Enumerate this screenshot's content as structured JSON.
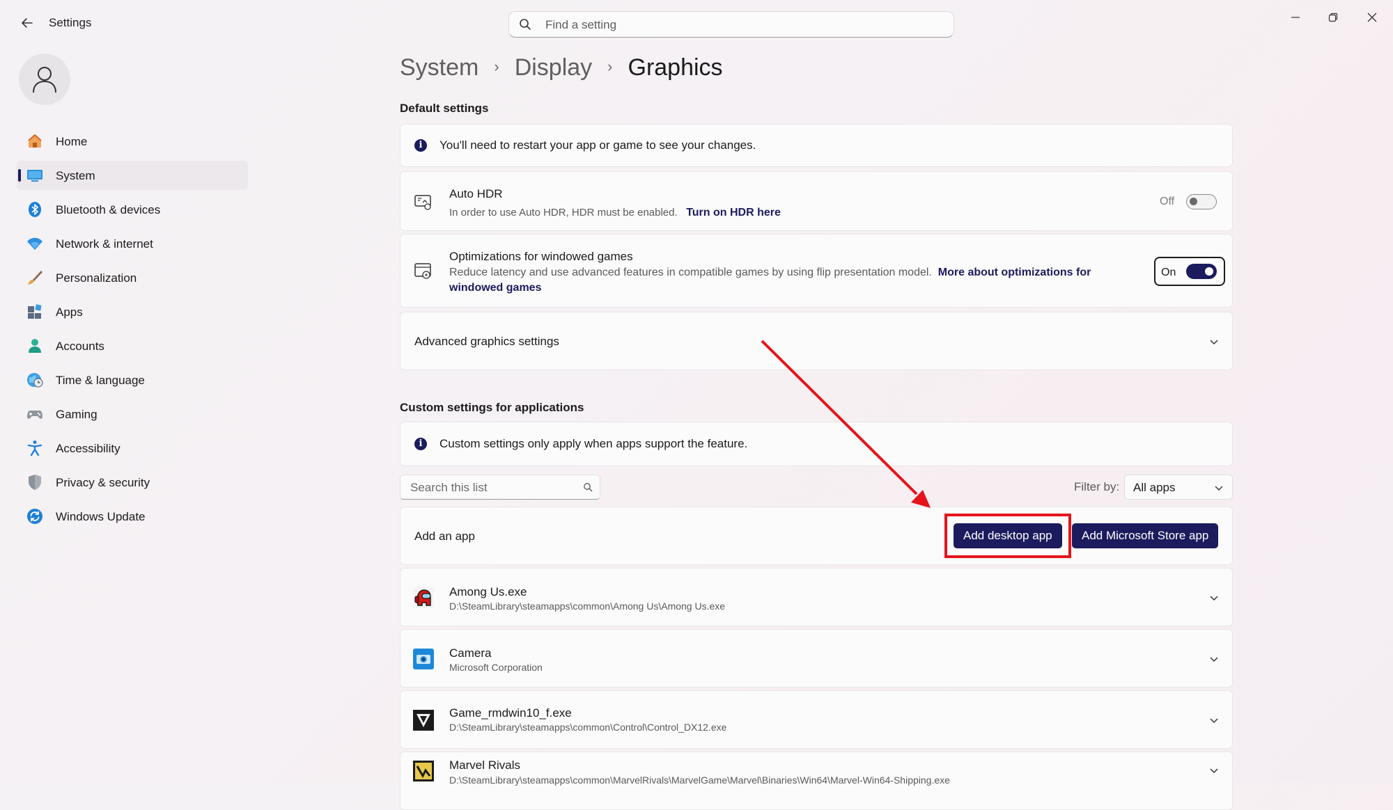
{
  "window": {
    "app_title": "Settings",
    "search_placeholder": "Find a setting"
  },
  "sidebar": {
    "items": [
      {
        "label": "Home",
        "icon": "home-icon"
      },
      {
        "label": "System",
        "icon": "system-icon",
        "active": true
      },
      {
        "label": "Bluetooth & devices",
        "icon": "bluetooth-icon"
      },
      {
        "label": "Network & internet",
        "icon": "network-icon"
      },
      {
        "label": "Personalization",
        "icon": "brush-icon"
      },
      {
        "label": "Apps",
        "icon": "apps-icon"
      },
      {
        "label": "Accounts",
        "icon": "accounts-icon"
      },
      {
        "label": "Time & language",
        "icon": "globe-clock-icon"
      },
      {
        "label": "Gaming",
        "icon": "gamepad-icon"
      },
      {
        "label": "Accessibility",
        "icon": "accessibility-icon"
      },
      {
        "label": "Privacy & security",
        "icon": "shield-icon"
      },
      {
        "label": "Windows Update",
        "icon": "update-icon"
      }
    ]
  },
  "breadcrumb": {
    "parts": [
      "System",
      "Display"
    ],
    "current": "Graphics"
  },
  "default_settings": {
    "title": "Default settings",
    "restart_notice": "You'll need to restart your app or game to see your changes.",
    "auto_hdr": {
      "title": "Auto HDR",
      "description": "In order to use Auto HDR, HDR must be enabled.",
      "link": "Turn on HDR here",
      "state_label": "Off",
      "enabled": false
    },
    "windowed_games": {
      "title": "Optimizations for windowed games",
      "description": "Reduce latency and use advanced features in compatible games by using flip presentation model.",
      "link_part1": "More about optimizations for",
      "link_part2": "windowed games",
      "state_label": "On",
      "enabled": true
    },
    "advanced": {
      "title": "Advanced graphics settings"
    }
  },
  "custom_settings": {
    "title": "Custom settings for applications",
    "notice": "Custom settings only apply when apps support the feature.",
    "search_placeholder": "Search this list",
    "filter_label": "Filter by:",
    "filter_value": "All apps",
    "add_app_label": "Add an app",
    "add_desktop_button": "Add desktop app",
    "add_store_button": "Add Microsoft Store app",
    "apps": [
      {
        "name": "Among Us.exe",
        "detail": "D:\\SteamLibrary\\steamapps\\common\\Among Us\\Among Us.exe",
        "icon": "among-us-icon"
      },
      {
        "name": "Camera",
        "detail": "Microsoft Corporation",
        "icon": "camera-icon"
      },
      {
        "name": "Game_rmdwin10_f.exe",
        "detail": "D:\\SteamLibrary\\steamapps\\common\\Control\\Control_DX12.exe",
        "icon": "control-game-icon"
      },
      {
        "name": "Marvel Rivals",
        "detail": "D:\\SteamLibrary\\steamapps\\common\\MarvelRivals\\MarvelGame\\Marvel\\Binaries\\Win64\\Marvel-Win64-Shipping.exe",
        "icon": "marvel-rivals-icon"
      }
    ]
  },
  "colors": {
    "accent": "#1b1b5e",
    "annotation_red": "#e5141b"
  }
}
